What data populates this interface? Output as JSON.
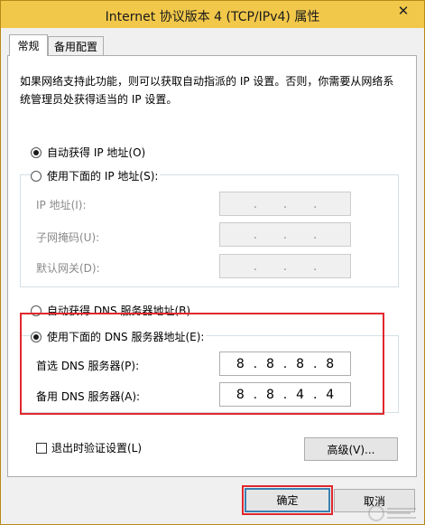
{
  "window": {
    "title": "Internet 协议版本 4 (TCP/IPv4) 属性",
    "close_glyph": "✕"
  },
  "tabs": [
    {
      "label": "常规",
      "active": true
    },
    {
      "label": "备用配置",
      "active": false
    }
  ],
  "description": "如果网络支持此功能，则可以获取自动指派的 IP 设置。否则，你需要从网络系统管理员处获得适当的 IP 设置。",
  "ip": {
    "auto_label": "自动获得 IP 地址(O)",
    "auto_checked": true,
    "manual_label": "使用下面的 IP 地址(S):",
    "manual_checked": false,
    "fields": [
      {
        "label": "IP 地址(I):",
        "octets": [
          "",
          "",
          "",
          ""
        ]
      },
      {
        "label": "子网掩码(U):",
        "octets": [
          "",
          "",
          "",
          ""
        ]
      },
      {
        "label": "默认网关(D):",
        "octets": [
          "",
          "",
          "",
          ""
        ]
      }
    ]
  },
  "dns": {
    "auto_label": "自动获得 DNS 服务器地址(B)",
    "auto_checked": false,
    "manual_label": "使用下面的 DNS 服务器地址(E):",
    "manual_checked": true,
    "preferred": {
      "label": "首选 DNS 服务器(P):",
      "octets": [
        "8",
        "8",
        "8",
        "8"
      ]
    },
    "alternate": {
      "label": "备用 DNS 服务器(A):",
      "octets": [
        "8",
        "8",
        "4",
        "4"
      ]
    }
  },
  "validate_on_exit": {
    "label": "退出时验证设置(L)",
    "checked": false
  },
  "buttons": {
    "advanced": "高级(V)...",
    "ok": "确定",
    "cancel": "取消"
  },
  "dot": ".",
  "colors": {
    "titlebar": "#f2c84a",
    "highlight": "#e0282e",
    "default_button_border": "#3c7fb1"
  }
}
